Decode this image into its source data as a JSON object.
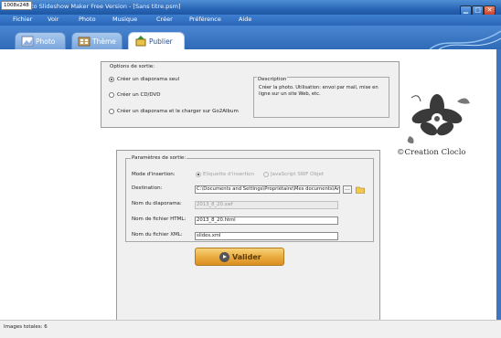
{
  "window": {
    "dimension_tag": "1008x248",
    "title": "Photo Slideshow Maker Free Version - [Sans titre.psm]",
    "top_fragment": "oto - Microsoft Word"
  },
  "menu": [
    "Fichier",
    "Voir",
    "Photo",
    "Musique",
    "Créer",
    "Préférence",
    "Aide"
  ],
  "tabs": [
    {
      "label": "Photo",
      "icon": "photo-icon",
      "active": false
    },
    {
      "label": "Thème",
      "icon": "theme-icon",
      "active": false
    },
    {
      "label": "Publier",
      "icon": "publish-icon",
      "active": true
    }
  ],
  "options_sortie": {
    "legend": "Options de sortie:",
    "choices": [
      {
        "label": "Créer un diaporama seul",
        "selected": true
      },
      {
        "label": "Créer un CD/DVD",
        "selected": false
      },
      {
        "label": "Créer un diaporama et le charger sur Go2Album",
        "selected": false
      }
    ],
    "description_title": "Description",
    "description_text_1": "Créer la photo. Utilisation: envoi par mail, mise en",
    "description_text_2": "ligne sur un site Web, etc."
  },
  "parametres": {
    "legend": "Paramètres de sortie:",
    "mode_label": "Mode d'insertion:",
    "mode_options": [
      "Etiquette d'insertion",
      "JavaScript SWF Objet"
    ],
    "destination_label": "Destination:",
    "destination_value": "C:\\Documents and Settings\\Propriétaire\\Mes documents\\Anvsof",
    "browse_label": "...",
    "diaporama_label": "Nom du diaporama:",
    "diaporama_value": "2013_8_20.swf",
    "html_label": "Nom de fichier HTML:",
    "html_value": "2013_8_20.html",
    "xml_label": "Nom du fichier XML:",
    "xml_value": "slides.xml"
  },
  "validate_label": "Valider",
  "watermark_text": "©Creation Cloclo",
  "status": "Images totales: 6",
  "colors": {
    "titlebar": "#2a66b5",
    "menubar": "#2b66b8",
    "panel_bg": "#f0f0f0",
    "validate_button": "#e9a93c"
  }
}
